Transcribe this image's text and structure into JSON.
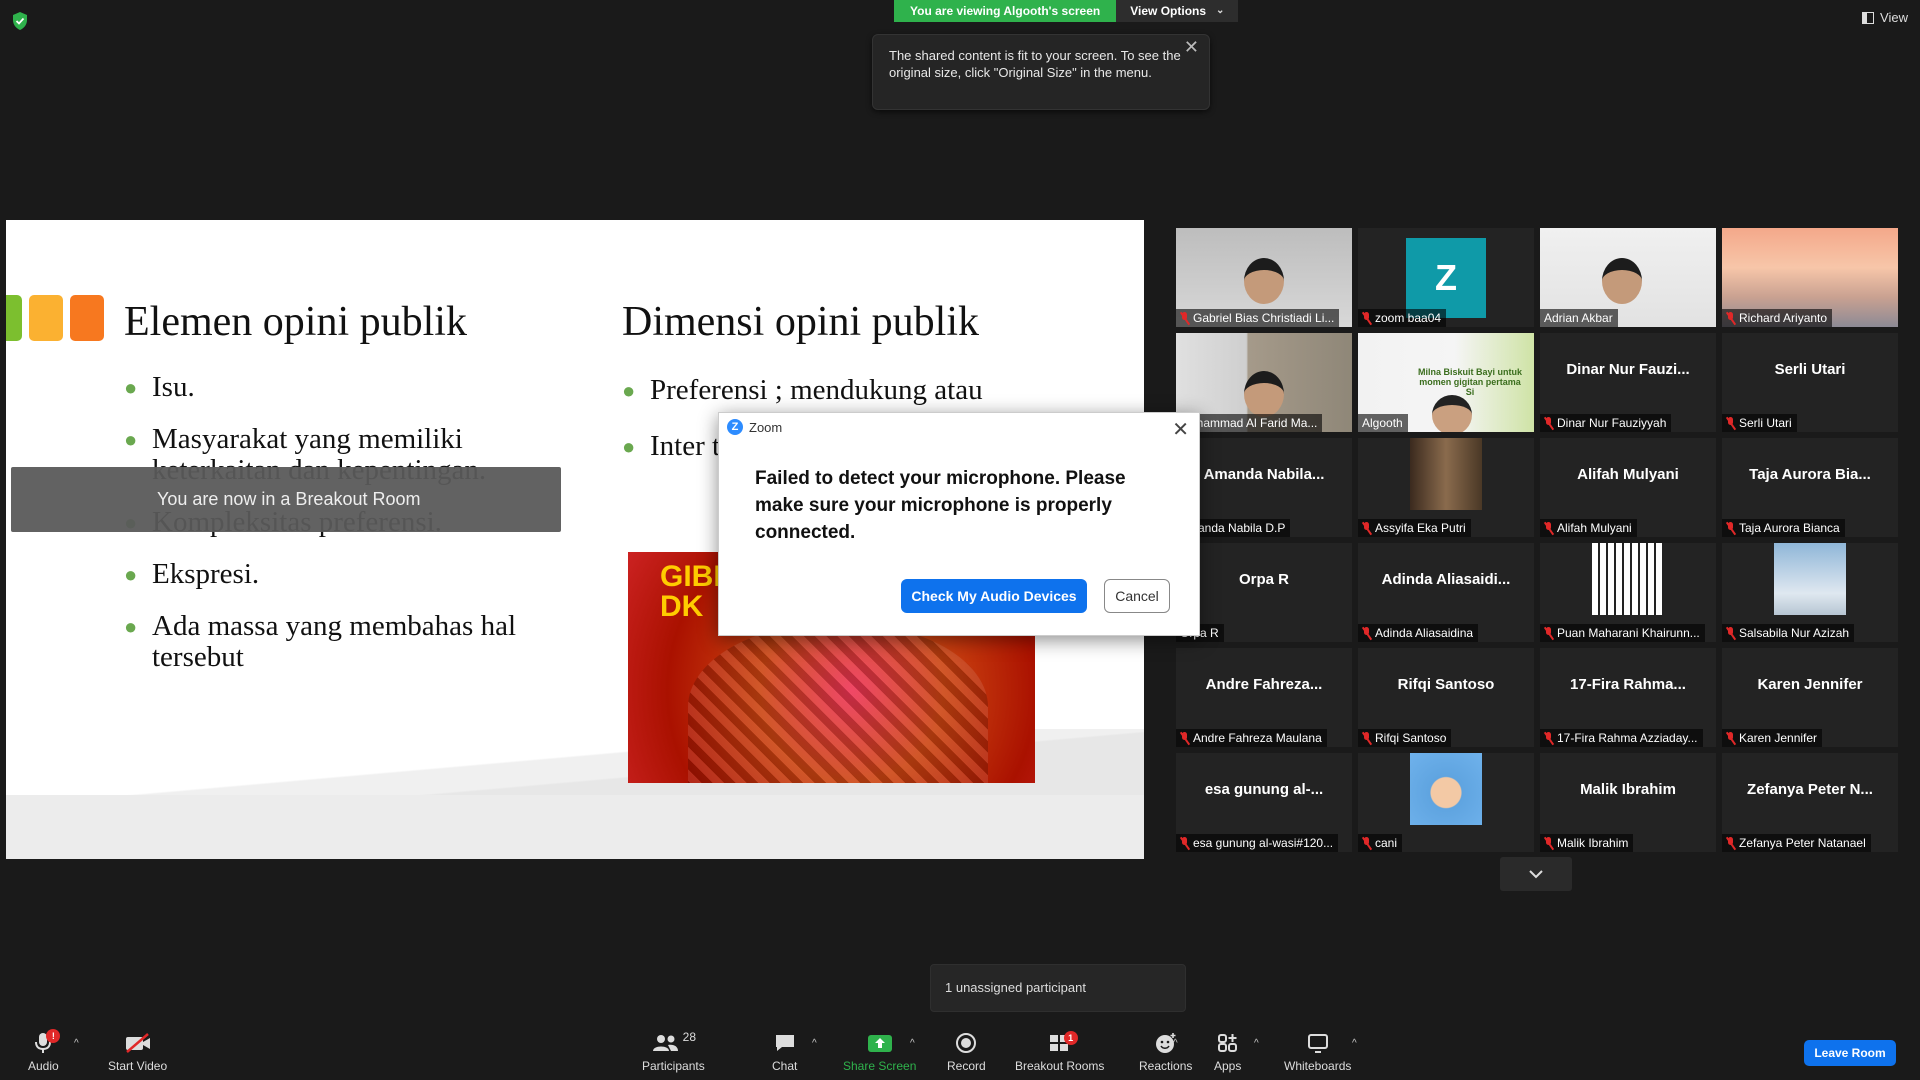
{
  "top": {
    "banner_viewing": "You are viewing Algooth's screen",
    "view_options": "View Options",
    "view": "View"
  },
  "tooltip": {
    "text": "The shared content is fit to your screen. To see the original size, click \"Original Size\" in the menu."
  },
  "slide": {
    "left_title": "Elemen opini publik",
    "left_bullets": [
      "Isu.",
      "Masyarakat yang memiliki keterkaitan dan kepentingan.",
      "Kompleksitas preferensi.",
      "Ekspresi.",
      "Ada massa yang membahas hal tersebut"
    ],
    "right_title": "Dimensi opini publik",
    "right_bullets": [
      "Preferensi ; mendukung atau",
      "Inter topik"
    ],
    "image_text": "GIBR\nDK",
    "square_colors": [
      "#7cbf2f",
      "#fbb131",
      "#f7781f"
    ],
    "breakout_banner": "You are now in a Breakout Room"
  },
  "dialog": {
    "title": "Zoom",
    "message": "Failed to detect your microphone. Please make sure your microphone is properly connected.",
    "primary": "Check My Audio Devices",
    "secondary": "Cancel"
  },
  "gallery": [
    {
      "label": "Gabriel Bias Christiadi Li...",
      "name": "",
      "muted": true
    },
    {
      "label": "zoom baa04",
      "name": "",
      "muted": true
    },
    {
      "label": "Adrian Akbar",
      "name": "",
      "muted": false
    },
    {
      "label": "Richard Ariyanto",
      "name": "",
      "muted": true
    },
    {
      "label": "Muhammad Al Farid Ma...",
      "name": "",
      "muted": false
    },
    {
      "label": "Algooth",
      "name": "",
      "muted": false
    },
    {
      "label": "Dinar Nur Fauziyyah",
      "name": "Dinar Nur Fauzi...",
      "muted": true
    },
    {
      "label": "Serli Utari",
      "name": "Serli Utari",
      "muted": true
    },
    {
      "label": "Amanda Nabila D.P",
      "name": "Amanda Nabila...",
      "muted": false
    },
    {
      "label": "Assyifa Eka Putri",
      "name": "",
      "muted": true
    },
    {
      "label": "Alifah Mulyani",
      "name": "Alifah Mulyani",
      "muted": true
    },
    {
      "label": "Taja Aurora Bianca",
      "name": "Taja Aurora Bia...",
      "muted": true
    },
    {
      "label": "Orpa R",
      "name": "Orpa R",
      "muted": false
    },
    {
      "label": "Adinda Aliasaidina",
      "name": "Adinda Aliasaidi...",
      "muted": true
    },
    {
      "label": "Puan Maharani Khairunn...",
      "name": "",
      "muted": true
    },
    {
      "label": "Salsabila Nur Azizah",
      "name": "",
      "muted": true
    },
    {
      "label": "Andre Fahreza Maulana",
      "name": "Andre Fahreza...",
      "muted": true
    },
    {
      "label": "Rifqi Santoso",
      "name": "Rifqi Santoso",
      "muted": true
    },
    {
      "label": "17-Fira Rahma Azziaday...",
      "name": "17-Fira Rahma...",
      "muted": true
    },
    {
      "label": "Karen Jennifer",
      "name": "Karen Jennifer",
      "muted": true
    },
    {
      "label": "esa gunung al-wasi#120...",
      "name": "esa gunung al-...",
      "muted": true
    },
    {
      "label": "cani",
      "name": "",
      "muted": true
    },
    {
      "label": "Malik Ibrahim",
      "name": "Malik Ibrahim",
      "muted": true
    },
    {
      "label": "Zefanya Peter Natanael",
      "name": "Zefanya Peter N...",
      "muted": true
    }
  ],
  "algooth_ad": "Milna Biskuit Bayi untuk momen gigitan pertama Si",
  "zoom_avatar_letter": "Z",
  "unassigned": "1 unassigned participant",
  "toolbar": {
    "audio": "Audio",
    "audio_badge": "!",
    "start_video": "Start Video",
    "participants": "Participants",
    "participants_count": "28",
    "chat": "Chat",
    "share_screen": "Share Screen",
    "record": "Record",
    "breakout_rooms": "Breakout Rooms",
    "breakout_badge": "1",
    "reactions": "Reactions",
    "apps": "Apps",
    "whiteboards": "Whiteboards",
    "leave_room": "Leave Room"
  },
  "colors": {
    "share_green": "#2fb24c",
    "zoom_blue": "#0e72ed",
    "muted_red": "#e02828",
    "active_speaker": "#c8e04b"
  }
}
